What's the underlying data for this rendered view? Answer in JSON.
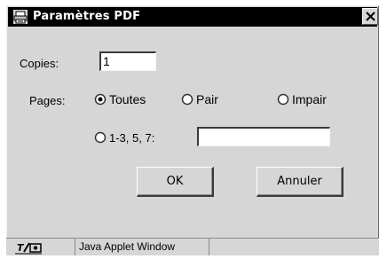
{
  "window": {
    "title": "Paramètres PDF",
    "title_icon": "printer-icon",
    "close_icon": "close-icon"
  },
  "copies": {
    "label": "Copies:",
    "value": "1"
  },
  "pages": {
    "label": "Pages:",
    "options": [
      {
        "label": "Toutes",
        "selected": true
      },
      {
        "label": "Pair",
        "selected": false
      },
      {
        "label": "Impair",
        "selected": false
      },
      {
        "label": "1-3, 5, 7:",
        "selected": false
      }
    ],
    "range_value": ""
  },
  "buttons": {
    "ok": "OK",
    "cancel": "Annuler"
  },
  "statusbar": {
    "text": "Java Applet Window",
    "icon": "java-applet-icon"
  }
}
